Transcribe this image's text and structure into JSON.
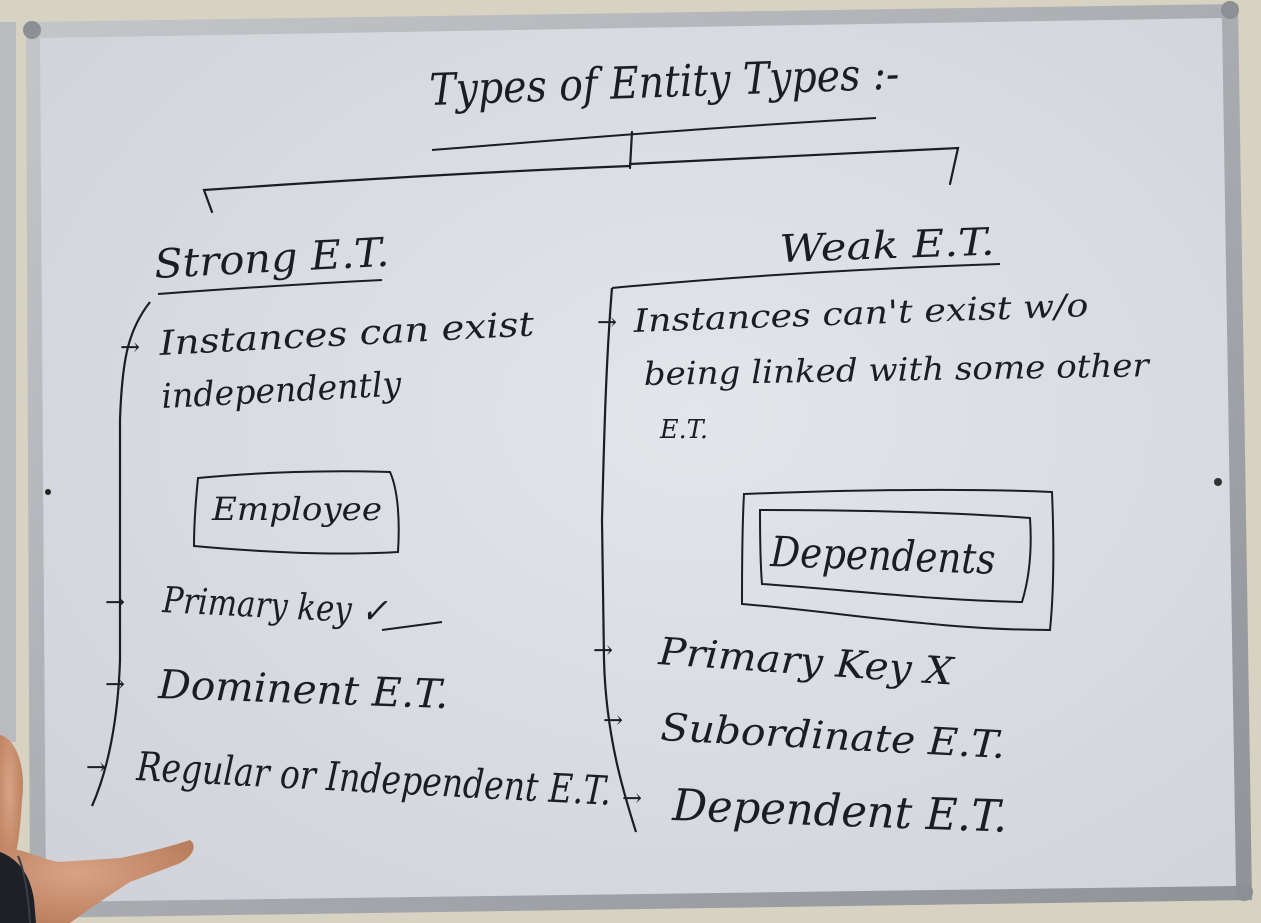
{
  "board": {
    "title": "Types of Entity Types :-",
    "left": {
      "heading": "Strong E.T.",
      "points": [
        "Instances can exist",
        "independently"
      ],
      "example_box": "Employee",
      "bullets": [
        "Primary key ✓",
        "Dominent E.T.",
        "Regular or Independent E.T."
      ]
    },
    "right": {
      "heading": "Weak E.T.",
      "points": [
        "Instances can't exist w/o",
        "being linked with some other",
        "E.T."
      ],
      "example_box": "Dependents",
      "bullets": [
        "Primary Key X",
        "Subordinate E.T.",
        "Dependent E.T."
      ]
    }
  },
  "colors": {
    "board": "#dfe1e6",
    "ink": "#1c1c24",
    "frame": "#a7a9ad",
    "wall": "#d8d2c2",
    "skin": "#c98f6e"
  }
}
